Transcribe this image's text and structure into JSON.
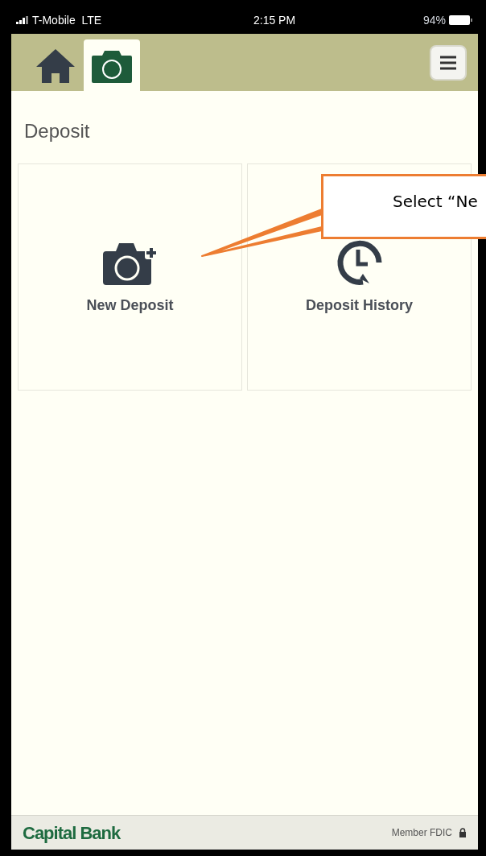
{
  "status_bar": {
    "carrier": "T-Mobile  LTE",
    "time": "2:15 PM",
    "battery": "94%"
  },
  "tabs": [
    {
      "kind": "home",
      "selected": false
    },
    {
      "kind": "camera",
      "selected": true
    }
  ],
  "page_title": "Deposit",
  "tiles": [
    {
      "kind": "new",
      "label": "New Deposit"
    },
    {
      "kind": "history",
      "label": "Deposit History"
    }
  ],
  "callout": {
    "text": "Select “Ne"
  },
  "footer": {
    "brand": "Capital Bank",
    "note": "Member FDIC"
  }
}
